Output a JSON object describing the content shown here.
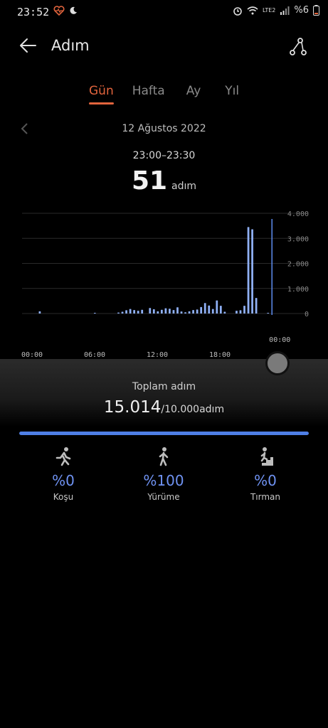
{
  "status": {
    "time": "23:52",
    "network": "LTE2",
    "battery": "%6"
  },
  "header": {
    "title": "Adım"
  },
  "tabs": [
    {
      "label": "Gün",
      "active": true
    },
    {
      "label": "Hafta",
      "active": false
    },
    {
      "label": "Ay",
      "active": false
    },
    {
      "label": "Yıl",
      "active": false
    }
  ],
  "date": "12 Ağustos 2022",
  "selection": {
    "range": "23:00–23:30",
    "value": "51",
    "unit": "adım"
  },
  "total": {
    "label": "Toplam adım",
    "value": "15.014",
    "goal": "/10.000adım",
    "progress": 1.0
  },
  "activities": [
    {
      "icon": "running-icon",
      "pct": "%0",
      "label": "Koşu"
    },
    {
      "icon": "walking-icon",
      "pct": "%100",
      "label": "Yürüme"
    },
    {
      "icon": "climbing-icon",
      "pct": "%0",
      "label": "Tırman"
    }
  ],
  "colors": {
    "accent": "#e2643d",
    "bar": "#8fb0f5",
    "progress": "#4f7fe6"
  },
  "chart_data": {
    "type": "bar",
    "y_ticks": [
      "4.000",
      "3.000",
      "2.000",
      "1.000",
      "0"
    ],
    "ylim": [
      0,
      4000
    ],
    "x_ticks": [
      "00:00",
      "06:00",
      "12:00",
      "18:00"
    ],
    "cursor_label": "00:00",
    "values": [
      0,
      0,
      0,
      0,
      90,
      0,
      0,
      0,
      0,
      0,
      0,
      0,
      0,
      0,
      0,
      0,
      0,
      0,
      30,
      0,
      0,
      0,
      0,
      0,
      40,
      70,
      130,
      180,
      140,
      110,
      150,
      0,
      220,
      170,
      90,
      150,
      210,
      190,
      140,
      250,
      80,
      50,
      90,
      140,
      160,
      260,
      420,
      320,
      180,
      520,
      310,
      70,
      0,
      0,
      110,
      130,
      310,
      3450,
      3360,
      620,
      0,
      0,
      30,
      0
    ],
    "cursor_index": 63
  }
}
